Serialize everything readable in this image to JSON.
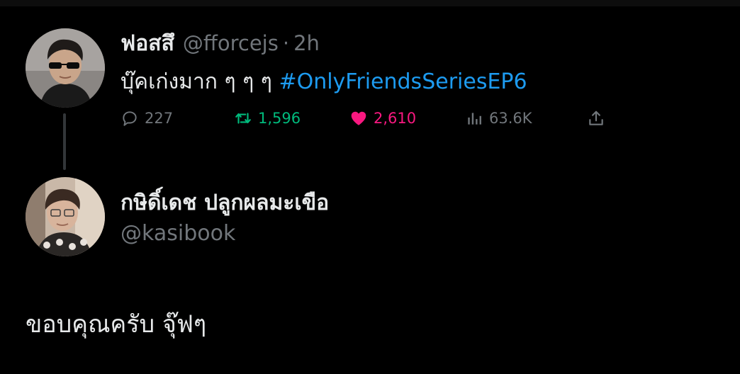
{
  "tweet": {
    "display_name": "ฟอสสึ",
    "handle": "@fforcejs",
    "separator": "·",
    "time": "2h",
    "text": "บุ๊คเก่งมาก  ๆ ๆ ๆ ",
    "hashtag": "#OnlyFriendsSeriesEP6",
    "metrics": {
      "replies": "227",
      "retweets": "1,596",
      "likes": "2,610",
      "views": "63.6K"
    },
    "colors": {
      "retweet": "#00ba7c",
      "like": "#f91880",
      "hashtag": "#1d9bf0",
      "muted": "#71767b"
    },
    "icons": [
      "reply-icon",
      "retweet-icon",
      "like-icon",
      "views-icon",
      "share-icon"
    ]
  },
  "reply": {
    "display_name": "กษิดิ์เดช ปลูกผลมะเขือ",
    "handle": "@kasibook",
    "text": "ขอบคุณครับ จุ๊ฟๆ"
  }
}
